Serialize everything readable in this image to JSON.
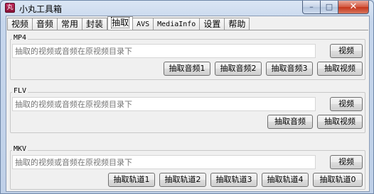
{
  "window": {
    "title": "小丸工具箱",
    "app_icon_glyph": "丸"
  },
  "tabs": [
    "视频",
    "音频",
    "常用",
    "封装",
    "抽取",
    "AVS",
    "MediaInfo",
    "设置",
    "帮助"
  ],
  "active_tab": "抽取",
  "mp4": {
    "label": "MP4",
    "input_placeholder": "抽取的视频或音频在原视频目录下",
    "browse_label": "视频",
    "buttons": [
      "抽取音频1",
      "抽取音频2",
      "抽取音频3",
      "抽取视频"
    ]
  },
  "flv": {
    "label": "FLV",
    "input_placeholder": "抽取的视频或音频在原视频目录下",
    "browse_label": "视频",
    "buttons": [
      "抽取音频",
      "抽取视频"
    ]
  },
  "mkv": {
    "label": "MKV",
    "input_placeholder": "抽取的视频或音频在原视频目录下",
    "browse_label": "视频",
    "buttons": [
      "抽取轨道1",
      "抽取轨道2",
      "抽取轨道3",
      "抽取轨道4",
      "抽取轨道0"
    ]
  },
  "colors": {
    "close_button": "#c4351b",
    "title_bar": "#c6d6ec",
    "app_icon": "#8a1236"
  }
}
